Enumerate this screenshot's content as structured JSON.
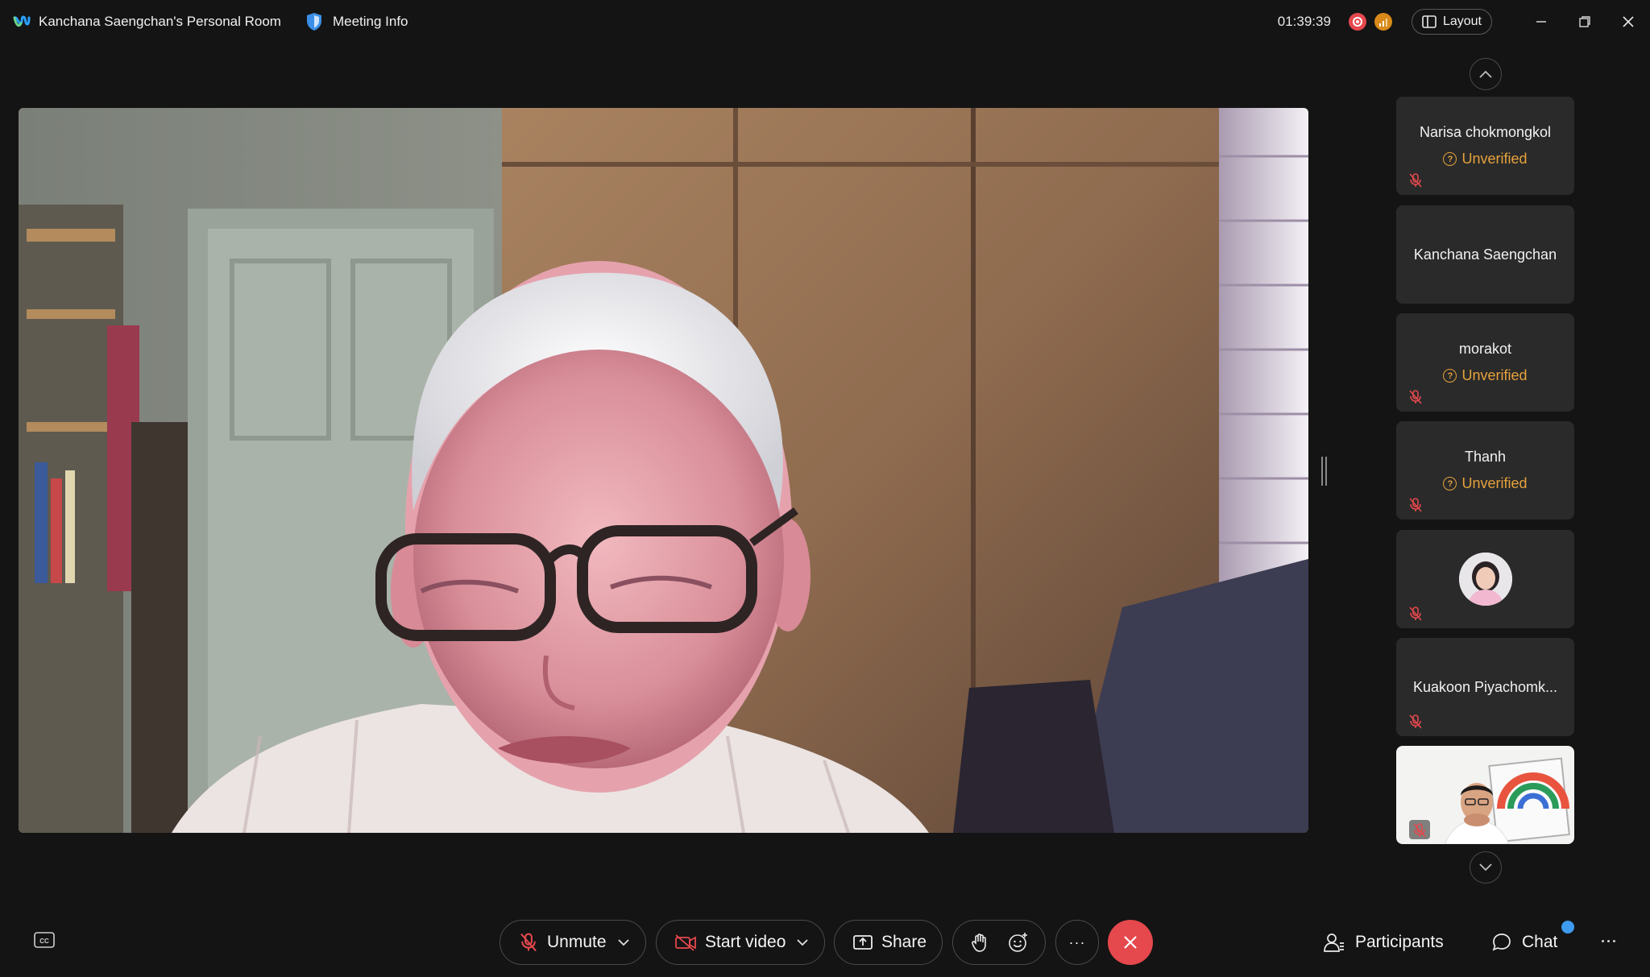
{
  "titlebar": {
    "room_title": "Kanchana Saengchan's Personal Room",
    "meeting_info_label": "Meeting Info",
    "timer": "01:39:39",
    "layout_label": "Layout"
  },
  "participants_strip": [
    {
      "name": "Narisa chokmongkol",
      "status": "Unverified",
      "muted": true,
      "type": "name"
    },
    {
      "name": "Kanchana Saengchan",
      "status": "",
      "muted": false,
      "type": "name"
    },
    {
      "name": "morakot",
      "status": "Unverified",
      "muted": true,
      "type": "name"
    },
    {
      "name": "Thanh",
      "status": "Unverified",
      "muted": true,
      "type": "name"
    },
    {
      "name": "",
      "status": "",
      "muted": true,
      "type": "avatar"
    },
    {
      "name": "Kuakoon Piyachomk...",
      "status": "",
      "muted": true,
      "type": "name"
    },
    {
      "name": "",
      "status": "",
      "muted": true,
      "type": "video"
    }
  ],
  "controls": {
    "unmute_label": "Unmute",
    "start_video_label": "Start video",
    "share_label": "Share",
    "more_label": "···",
    "participants_label": "Participants",
    "chat_label": "Chat"
  },
  "colors": {
    "background": "#141414",
    "tile": "#2a2a2a",
    "leave": "#e5484d",
    "unverified": "#e6a23c",
    "badge": "#3d9bf0"
  }
}
